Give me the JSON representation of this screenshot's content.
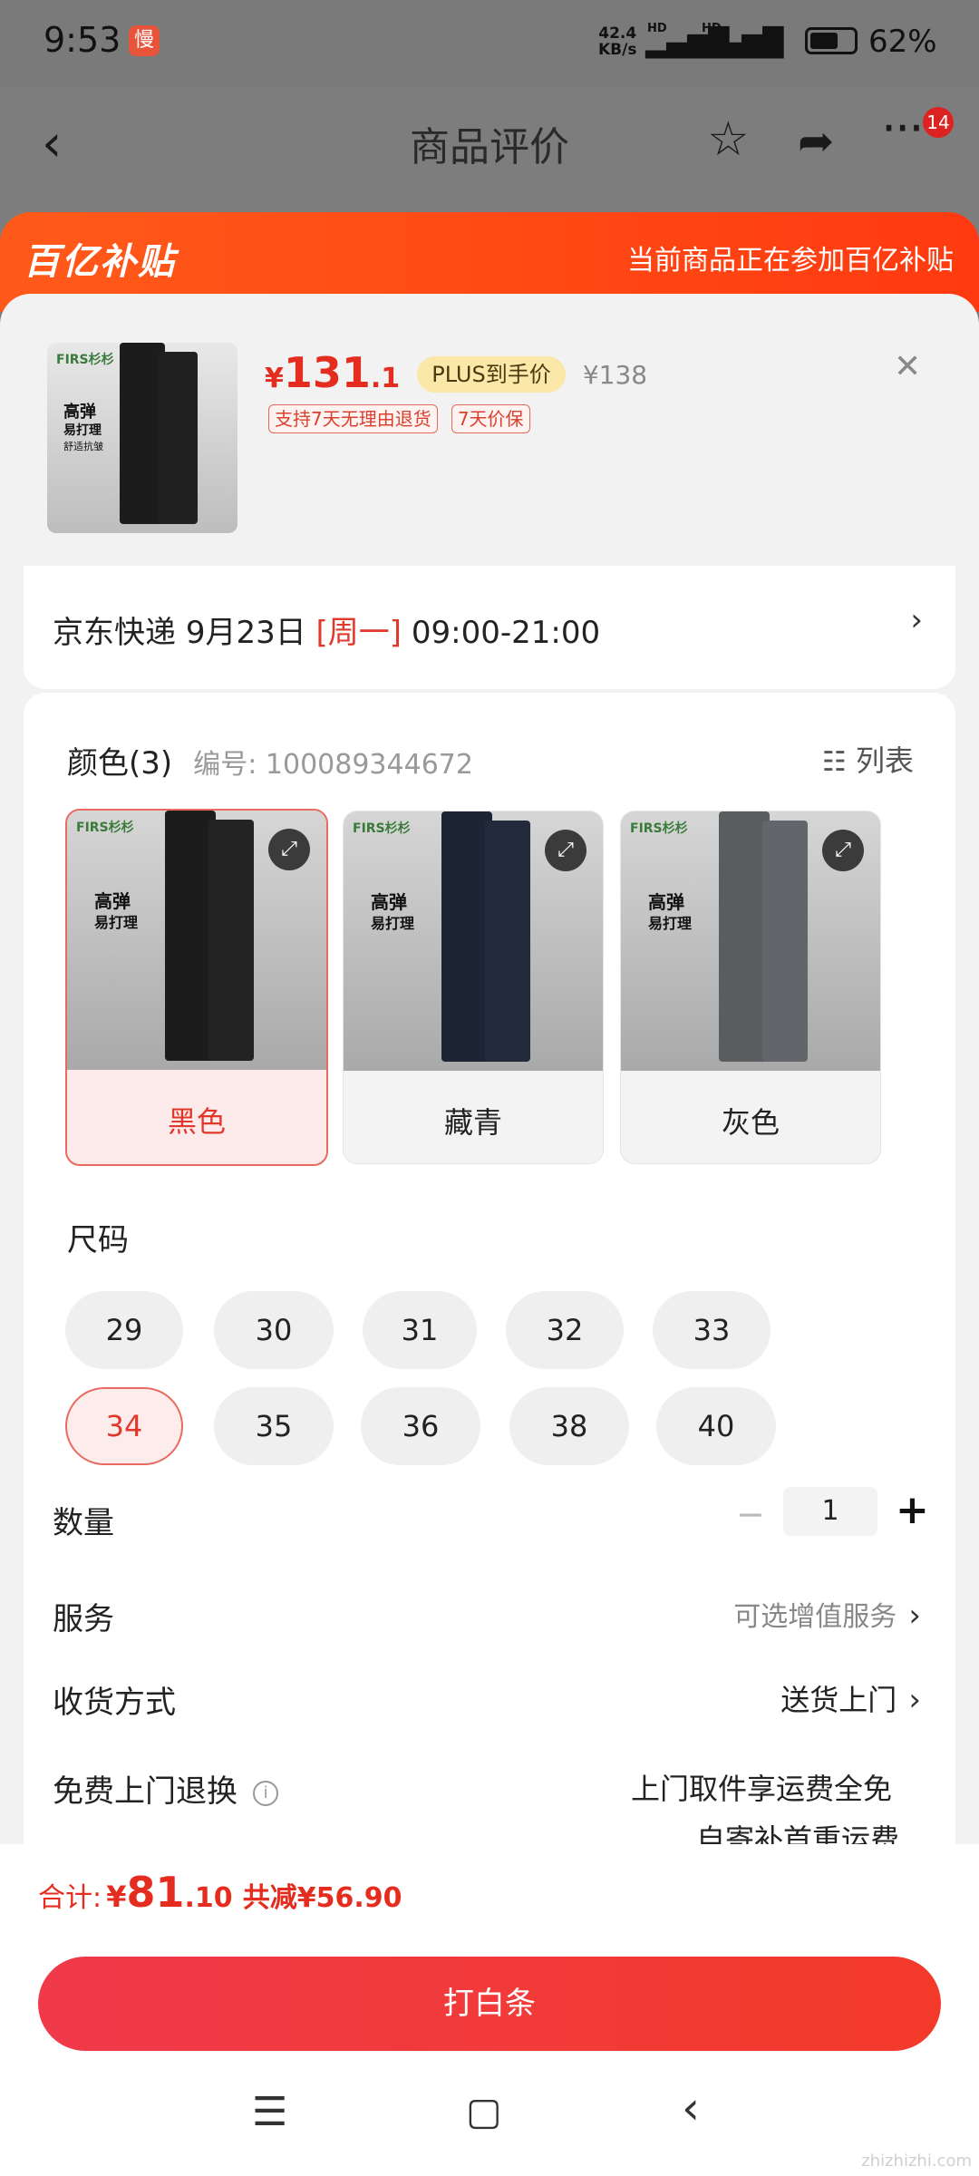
{
  "status": {
    "time": "9:53",
    "app_badge": "慢",
    "net_speed": "42.4",
    "net_unit": "KB/s",
    "hd1": "HD",
    "hd2": "HD",
    "battery": "62%"
  },
  "nav": {
    "title": "商品评价",
    "badge_count": "14"
  },
  "banner": {
    "logo": "百亿补贴",
    "note": "当前商品正在参加百亿补贴"
  },
  "product": {
    "brand": "FIRS杉杉",
    "thumb_text1": "高弹",
    "thumb_text2": "易打理",
    "thumb_text3": "舒适抗皱",
    "currency": "¥",
    "price_int": "131",
    "price_dec": ".1",
    "plus_label": "PLUS到手价",
    "original_price": "¥138",
    "tags": [
      "支持7天无理由退货",
      "7天价保"
    ]
  },
  "delivery": {
    "carrier": "京东快递",
    "date": "9月23日",
    "weekday": "[周一]",
    "time_window": "09:00-21:00"
  },
  "color_section": {
    "title": "颜色(3)",
    "sku_label": "编号: 100089344672",
    "list_label": "列表",
    "options": [
      {
        "label": "黑色",
        "selected": true,
        "pants": "#1c1c1c"
      },
      {
        "label": "藏青",
        "selected": false,
        "pants": "#1d2535"
      },
      {
        "label": "灰色",
        "selected": false,
        "pants": "#5a5d60"
      }
    ]
  },
  "size_section": {
    "title": "尺码",
    "sizes": [
      "29",
      "30",
      "31",
      "32",
      "33",
      "34",
      "35",
      "36",
      "38",
      "40"
    ],
    "selected": "34"
  },
  "quantity": {
    "label": "数量",
    "value": "1",
    "minus": "−",
    "plus": "+"
  },
  "service": {
    "label": "服务",
    "value": "可选增值服务"
  },
  "receive": {
    "label": "收货方式",
    "value": "送货上门"
  },
  "returns": {
    "label": "免费上门退换",
    "value_line1": "上门取件享运费全免",
    "value_line2": "自寄补首重运费"
  },
  "footer": {
    "total_label": "合计:",
    "total_currency": "¥",
    "total_int": "81",
    "total_dec": ".10",
    "discount": "共减¥56.90",
    "pay_button": "打白条"
  },
  "watermark": "zhizhizhi.com",
  "colors": {
    "accent": "#e52d1f",
    "banner": "#ff4a14",
    "plus_bg": "#fbe7a7"
  }
}
